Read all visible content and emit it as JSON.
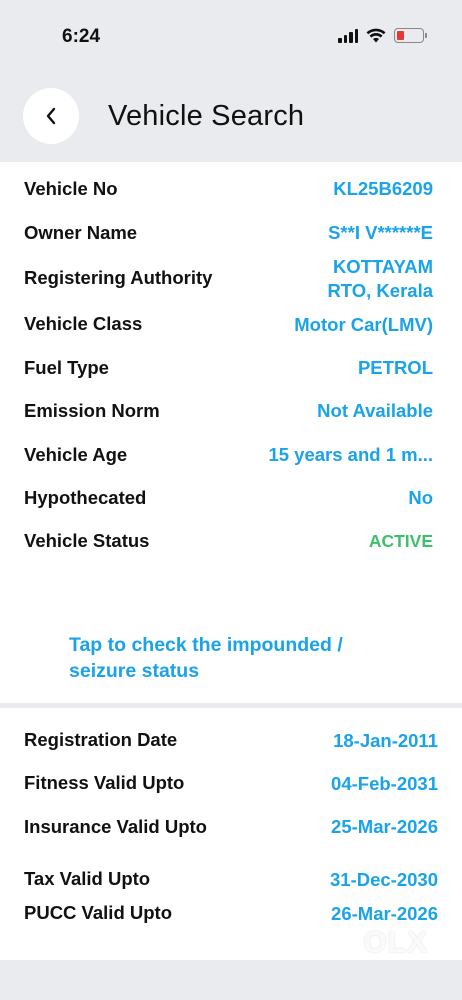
{
  "status_bar": {
    "time": "6:24",
    "icons": [
      "signal-icon",
      "wifi-icon",
      "battery-low-icon"
    ],
    "battery_color": "#e53935"
  },
  "header": {
    "title": "Vehicle Search",
    "back_icon": "chevron-left-icon"
  },
  "vehicle_details": [
    {
      "label": "Vehicle No",
      "value": "KL25B6209"
    },
    {
      "label": "Owner Name",
      "value": "S**I V******E"
    },
    {
      "label": "Registering Authority",
      "value_line1": "KOTTAYAM",
      "value_line2": "RTO, Kerala"
    },
    {
      "label": "Vehicle Class",
      "value": "Motor Car(LMV)"
    },
    {
      "label": "Fuel Type",
      "value": "PETROL"
    },
    {
      "label": "Emission Norm",
      "value": "Not Available"
    },
    {
      "label": "Vehicle Age",
      "value": "15 years and 1 m..."
    },
    {
      "label": "Hypothecated",
      "value": "No"
    },
    {
      "label": "Vehicle Status",
      "value": "ACTIVE"
    }
  ],
  "impound_link": {
    "line1": "Tap to check the impounded /",
    "line2": "seizure status"
  },
  "validity": [
    {
      "label": "Registration Date",
      "value": "18-Jan-2011"
    },
    {
      "label": "Fitness Valid Upto",
      "value": "04-Feb-2031"
    },
    {
      "label": "Insurance Valid Upto",
      "value": "25-Mar-2026"
    },
    {
      "label": "Tax Valid Upto",
      "value": "31-Dec-2030"
    },
    {
      "label": "PUCC Valid Upto",
      "value": "26-Mar-2026"
    }
  ],
  "watermark": {
    "text": "OLX"
  },
  "colors": {
    "accent": "#1aa3e8",
    "active": "#3fbf6a",
    "background": "#e9ebee",
    "card": "#ffffff"
  }
}
